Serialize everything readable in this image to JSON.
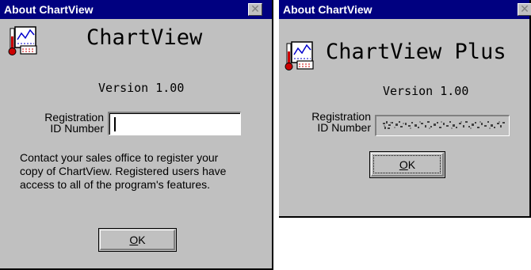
{
  "left_dialog": {
    "title": "About ChartView",
    "close_glyph": "✕",
    "icon": "chart-thermometer-icon",
    "app_name": "ChartView",
    "version": "Version 1.00",
    "reg_label_line1": "Registration",
    "reg_label_line2": "ID Number",
    "reg_value": "",
    "contact_line1": "Contact your sales office to register your",
    "contact_line2": "copy of ChartView.  Registered users have",
    "contact_line3": "access to all of the program's features.",
    "ok_mnemonic": "O",
    "ok_rest": "K"
  },
  "right_dialog": {
    "title": "About ChartView",
    "close_glyph": "✕",
    "icon": "chart-thermometer-icon",
    "app_name": "ChartView Plus",
    "version": "Version 1.00",
    "reg_label_line1": "Registration",
    "reg_label_line2": "ID Number",
    "ok_mnemonic": "O",
    "ok_rest": "K"
  },
  "colors": {
    "titlebar": "#000080",
    "dialog_face": "#c0c0c0",
    "accent_red": "#cc0000"
  }
}
